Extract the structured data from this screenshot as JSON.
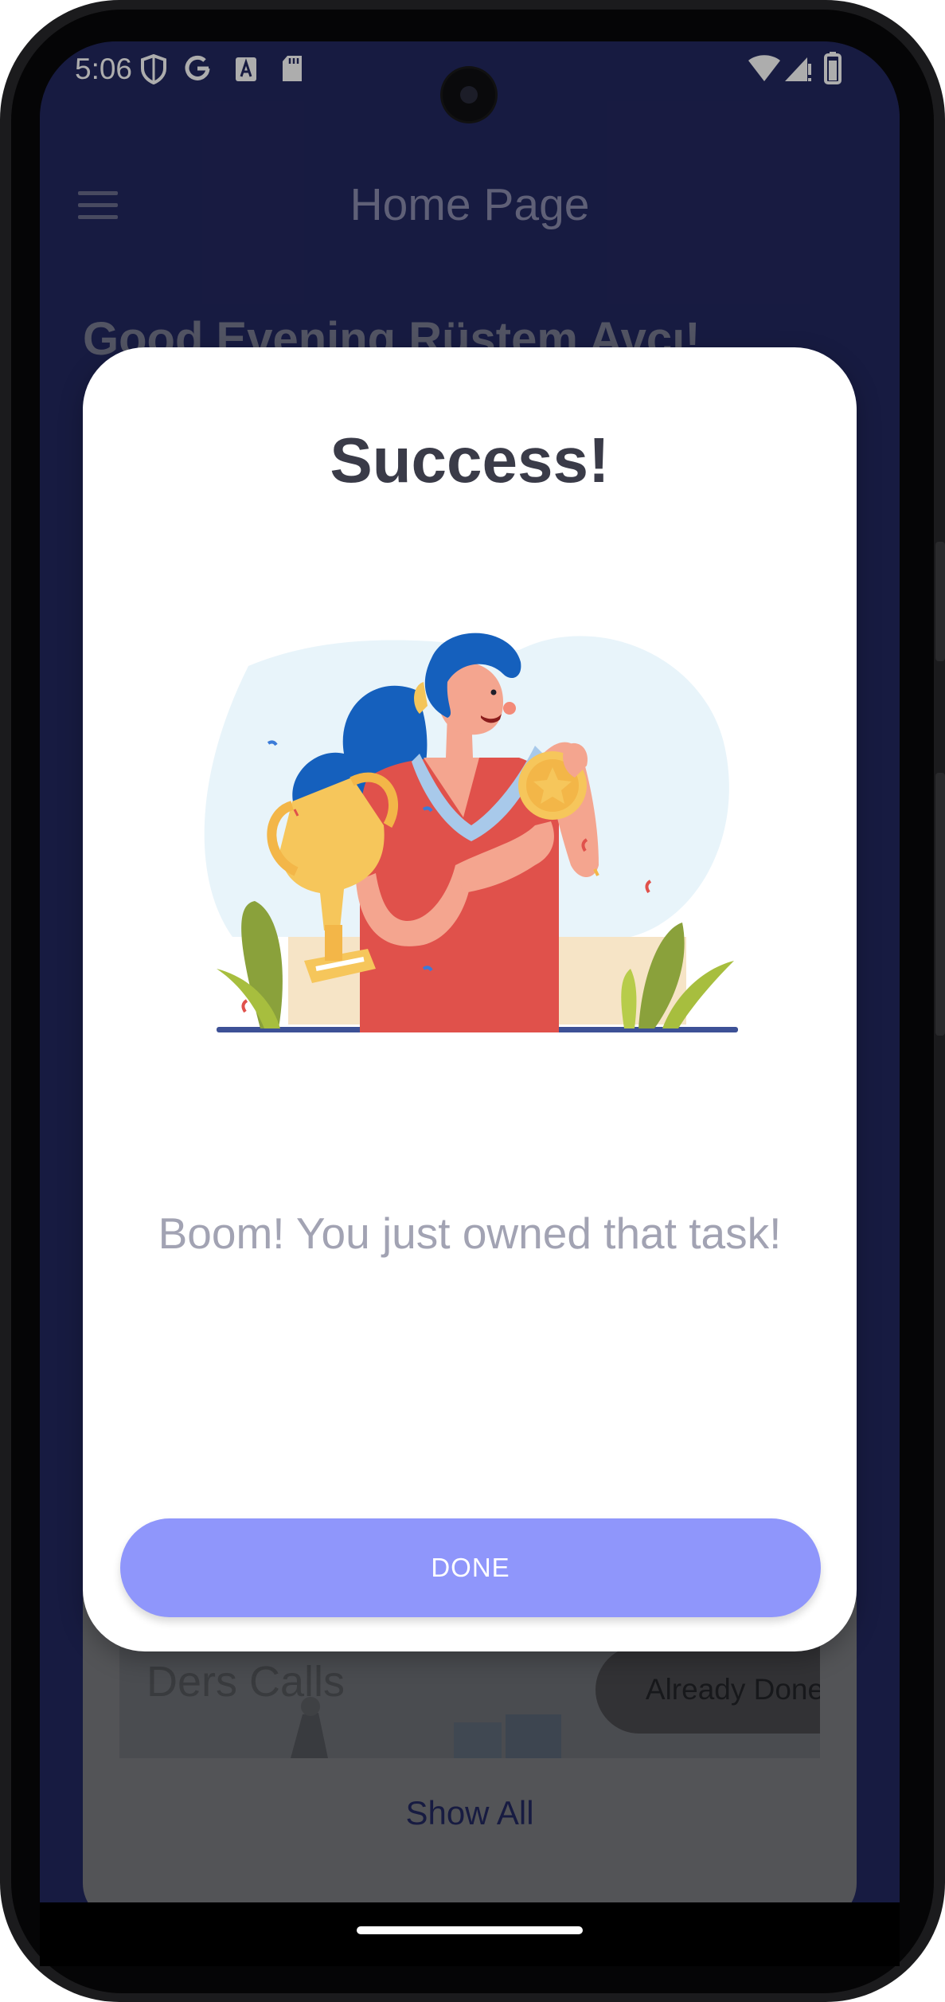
{
  "status_bar": {
    "time": "5:06",
    "icons": [
      "shield-icon",
      "google-icon",
      "text-a-icon",
      "sd-card-icon",
      "wifi-icon",
      "signal-icon",
      "battery-icon"
    ]
  },
  "app_bar": {
    "menu_icon": "hamburger-menu-icon",
    "title": "Home Page"
  },
  "background": {
    "greeting": "Good Evening Rüstem Avcı!",
    "course_name": "Ders Calls",
    "course_button": "Already Done",
    "show_all": "Show All"
  },
  "dialog": {
    "title": "Success!",
    "illustration": "trophy-medal-celebration-illustration",
    "message": "Boom! You just owned that task!",
    "done_label": "DONE"
  },
  "colors": {
    "app_background": "#232860",
    "dialog_background": "#ffffff",
    "done_button": "#8f96fb",
    "title_text": "#3a3b48",
    "message_text": "#a2a3b3"
  }
}
